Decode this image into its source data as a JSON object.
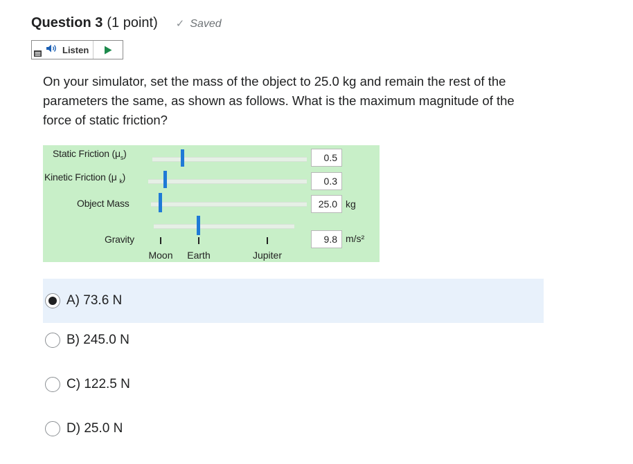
{
  "question": {
    "title": "Question 3",
    "points": "(1 point)",
    "status": "Saved",
    "text": "On your simulator, set the mass of the object to 25.0 kg and remain the rest of the parameters the same, as shown as follows. What is the maximum magnitude of the force of static friction?"
  },
  "listen": {
    "label": "Listen"
  },
  "simulator": {
    "static_friction": {
      "label": "Static Friction (μ",
      "sub": "s",
      "close": ")",
      "value": "0.5"
    },
    "kinetic_friction": {
      "label": "Kinetic Friction (μ ",
      "sub": "k",
      "close": ")",
      "value": "0.3"
    },
    "object_mass": {
      "label": "Object Mass",
      "value": "25.0",
      "unit": "kg"
    },
    "gravity": {
      "label": "Gravity",
      "value": "9.8",
      "unit": "m/s²",
      "ticks": [
        "Moon",
        "Earth",
        "Jupiter"
      ]
    }
  },
  "choices": [
    {
      "label": "A) 73.6 N",
      "selected": true
    },
    {
      "label": "B) 245.0 N",
      "selected": false
    },
    {
      "label": "C) 122.5 N",
      "selected": false
    },
    {
      "label": "D) 25.0 N",
      "selected": false
    }
  ],
  "colors": {
    "sim_background": "#c8efc8",
    "slider_thumb": "#1f7ad6",
    "selected_row": "#e8f1fb"
  }
}
